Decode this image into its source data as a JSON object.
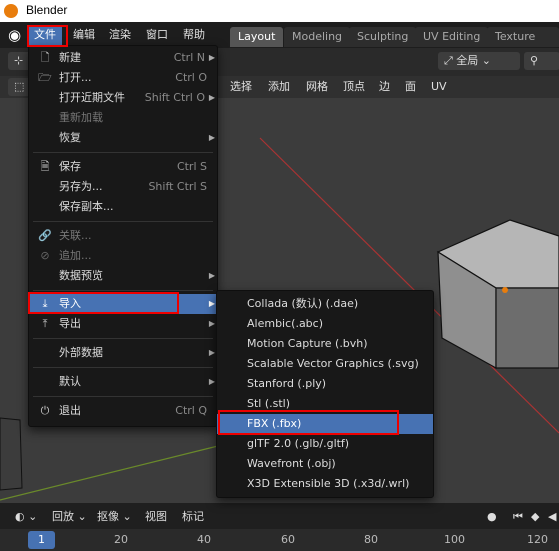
{
  "window": {
    "title": "Blender"
  },
  "menubar": {
    "items": [
      {
        "label": "文件"
      },
      {
        "label": "编辑"
      },
      {
        "label": "渲染"
      },
      {
        "label": "窗口"
      },
      {
        "label": "帮助"
      }
    ]
  },
  "workspace_tabs": [
    {
      "label": "Layout",
      "active": true
    },
    {
      "label": "Modeling"
    },
    {
      "label": "Sculpting"
    },
    {
      "label": "UV Editing"
    },
    {
      "label": "Texture Paint"
    }
  ],
  "viewport_header": {
    "transform_orientation": "全局",
    "menu": [
      "选择",
      "添加",
      "网格",
      "顶点",
      "边",
      "面",
      "UV"
    ]
  },
  "file_menu": {
    "items": [
      {
        "label": "新建",
        "shortcut": "Ctrl N",
        "icon": "new-file-icon",
        "submenu": true
      },
      {
        "label": "打开...",
        "shortcut": "Ctrl O",
        "icon": "open-folder-icon"
      },
      {
        "label": "打开近期文件",
        "shortcut": "Shift Ctrl O",
        "submenu": true
      },
      {
        "label": "重新加载",
        "disabled": true
      },
      {
        "label": "恢复",
        "submenu": true
      },
      {
        "label": "保存",
        "shortcut": "Ctrl S",
        "icon": "save-icon"
      },
      {
        "label": "另存为...",
        "shortcut": "Shift Ctrl S"
      },
      {
        "label": "保存副本..."
      },
      {
        "label": "关联...",
        "disabled": true,
        "icon": "link-icon"
      },
      {
        "label": "追加...",
        "disabled": true,
        "icon": "append-icon"
      },
      {
        "label": "数据预览",
        "submenu": true
      },
      {
        "label": "导入",
        "highlighted": true,
        "icon": "import-icon",
        "submenu": true
      },
      {
        "label": "导出",
        "icon": "export-icon",
        "submenu": true
      },
      {
        "label": "外部数据",
        "submenu": true
      },
      {
        "label": "默认",
        "submenu": true
      },
      {
        "label": "退出",
        "shortcut": "Ctrl Q",
        "icon": "power-icon"
      }
    ]
  },
  "import_submenu": {
    "items": [
      {
        "label": "Collada (数认) (.dae)"
      },
      {
        "label": "Alembic(.abc)"
      },
      {
        "label": "Motion Capture (.bvh)"
      },
      {
        "label": "Scalable Vector Graphics (.svg)"
      },
      {
        "label": "Stanford (.ply)"
      },
      {
        "label": "Stl (.stl)"
      },
      {
        "label": "FBX (.fbx)",
        "highlighted": true
      },
      {
        "label": "glTF 2.0 (.glb/.gltf)"
      },
      {
        "label": "Wavefront (.obj)"
      },
      {
        "label": "X3D Extensible 3D (.x3d/.wrl)"
      }
    ]
  },
  "timeline": {
    "playback_label": "回放",
    "keying_label": "抠像",
    "view_label": "视图",
    "marker_label": "标记",
    "current_frame": "1",
    "ticks": [
      "20",
      "40",
      "60",
      "80",
      "100",
      "120"
    ]
  },
  "colors": {
    "accent": "#4772b3",
    "highlight_box": "#ee0000",
    "orange": "#e87d0d"
  }
}
